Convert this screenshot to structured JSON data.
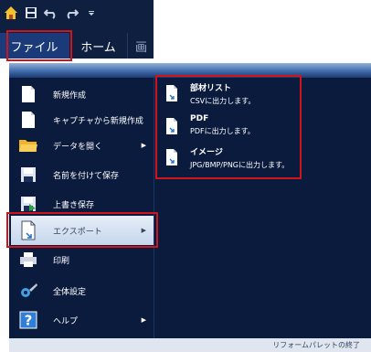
{
  "ribbon": {
    "tabs": {
      "file": "ファイル",
      "home": "ホーム",
      "view": "画"
    }
  },
  "menu": [
    {
      "label": "新規作成",
      "icon": "document-icon"
    },
    {
      "label": "キャプチャから新規作成",
      "icon": "document-icon"
    },
    {
      "label": "データを開く",
      "icon": "folder-icon",
      "arrow": "▶"
    },
    {
      "label": "名前を付けて保存",
      "icon": "save-icon"
    },
    {
      "label": "上書き保存",
      "icon": "save-overwrite-icon"
    },
    {
      "label": "エクスポート",
      "icon": "export-icon",
      "arrow": "▶",
      "active": true
    },
    {
      "label": "印刷",
      "icon": "printer-icon"
    },
    {
      "label": "全体設定",
      "icon": "settings-icon"
    },
    {
      "label": "ヘルプ",
      "icon": "help-icon",
      "arrow": "▶"
    }
  ],
  "export_submenu": [
    {
      "title": "部材リスト",
      "description": "CSVに出力します。",
      "icon": "export-icon"
    },
    {
      "title": "PDF",
      "description": "PDFに出力します。",
      "icon": "export-icon"
    },
    {
      "title": "イメージ",
      "description": "JPG/BMP/PNGに出力します。",
      "icon": "export-icon"
    }
  ],
  "footer": {
    "exit_label": "リフォームパレットの終了"
  },
  "colors": {
    "panel_bg": "#0b1b3d",
    "active_item_bg": "#d4e1f2",
    "highlight_red": "#d0141b",
    "file_tab_bg": "#1a3a7a"
  }
}
